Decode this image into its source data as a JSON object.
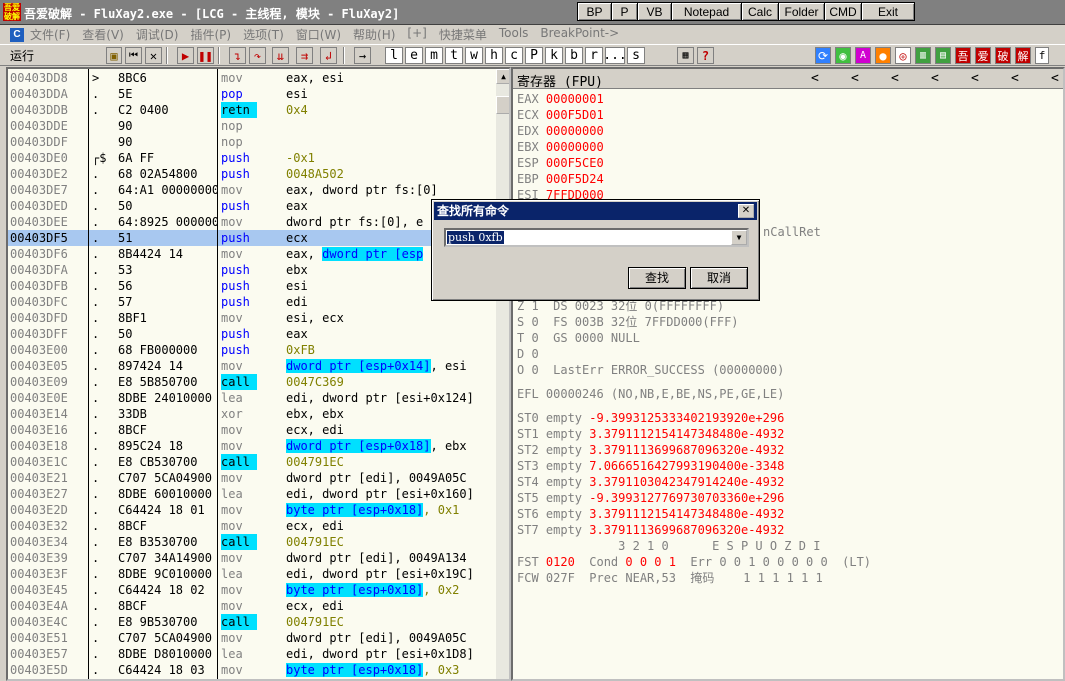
{
  "title": {
    "logo": "吾爱破解",
    "text": "吾爱破解 - FluXay2.exe - [LCG - 主线程, 模块 - FluXay2]"
  },
  "title_buttons": [
    {
      "label": "BP",
      "w": 34
    },
    {
      "label": "P",
      "w": 26
    },
    {
      "label": "VB",
      "w": 34
    },
    {
      "label": "Notepad",
      "w": 70
    },
    {
      "label": "Calc",
      "w": 37
    },
    {
      "label": "Folder",
      "w": 46
    },
    {
      "label": "CMD",
      "w": 37
    },
    {
      "label": "Exit",
      "w": 54
    }
  ],
  "menu": [
    "文件(F)",
    "查看(V)",
    "调试(D)",
    "插件(P)",
    "选项(T)",
    "窗口(W)",
    "帮助(H)",
    "[+]",
    "快捷菜单",
    "Tools",
    "BreakPoint->"
  ],
  "status": "运行",
  "toolbar_letters": [
    "l",
    "e",
    "m",
    "t",
    "w",
    "h",
    "c",
    "P",
    "k",
    "b",
    "r",
    "...",
    "s"
  ],
  "toolbar_right": [
    "吾",
    "爱",
    "破",
    "解"
  ],
  "disasm": [
    {
      "addr": "00403DD8",
      "mark": ">",
      "hex": "8BC6",
      "mn": "mov",
      "ops": "eax, esi"
    },
    {
      "addr": "00403DDA",
      "mark": ".",
      "hex": "5E",
      "mn": "pop",
      "mn_style": "blue",
      "ops": "esi"
    },
    {
      "addr": "00403DDB",
      "mark": ".",
      "hex": "C2 0400",
      "mn": "retn",
      "mn_style": "cyan",
      "ops": "0x4",
      "ops_style": "olive"
    },
    {
      "addr": "00403DDE",
      "mark": "",
      "hex": "90",
      "mn": "nop",
      "ops": ""
    },
    {
      "addr": "00403DDF",
      "mark": "",
      "hex": "90",
      "mn": "nop",
      "ops": ""
    },
    {
      "addr": "00403DE0",
      "mark": "┌$",
      "hex": "6A FF",
      "mn": "push",
      "mn_style": "blue",
      "ops": "-0x1",
      "ops_style": "olive"
    },
    {
      "addr": "00403DE2",
      "mark": ".",
      "hex": "68 02A54800",
      "mn": "push",
      "mn_style": "blue",
      "ops": "0048A502",
      "ops_style": "olive"
    },
    {
      "addr": "00403DE7",
      "mark": ".",
      "hex": "64:A1 00000000",
      "mn": "mov",
      "ops": "eax, dword ptr fs:[0]"
    },
    {
      "addr": "00403DED",
      "mark": ".",
      "hex": "50",
      "mn": "push",
      "mn_style": "blue",
      "ops": "eax"
    },
    {
      "addr": "00403DEE",
      "mark": ".",
      "hex": "64:8925 00000000",
      "mn": "mov",
      "ops": "dword ptr fs:[0], e"
    },
    {
      "addr": "00403DF5",
      "mark": ".",
      "hex": "51",
      "mn": "push",
      "mn_style": "blue",
      "ops": "ecx",
      "sel": true
    },
    {
      "addr": "00403DF6",
      "mark": ".",
      "hex": "8B4424 14",
      "mn": "mov",
      "ops_pre": "eax, ",
      "ops_hl": "dword ptr [esp"
    },
    {
      "addr": "00403DFA",
      "mark": ".",
      "hex": "53",
      "mn": "push",
      "mn_style": "blue",
      "ops": "ebx"
    },
    {
      "addr": "00403DFB",
      "mark": ".",
      "hex": "56",
      "mn": "push",
      "mn_style": "blue",
      "ops": "esi"
    },
    {
      "addr": "00403DFC",
      "mark": ".",
      "hex": "57",
      "mn": "push",
      "mn_style": "blue",
      "ops": "edi"
    },
    {
      "addr": "00403DFD",
      "mark": ".",
      "hex": "8BF1",
      "mn": "mov",
      "ops": "esi, ecx"
    },
    {
      "addr": "00403DFF",
      "mark": ".",
      "hex": "50",
      "mn": "push",
      "mn_style": "blue",
      "ops": "eax"
    },
    {
      "addr": "00403E00",
      "mark": ".",
      "hex": "68 FB000000",
      "mn": "push",
      "mn_style": "blue",
      "ops": "0xFB",
      "ops_style": "olive"
    },
    {
      "addr": "00403E05",
      "mark": ".",
      "hex": "897424 14",
      "mn": "mov",
      "ops_hl": "dword ptr [esp+0x14]",
      "ops_post": ", esi"
    },
    {
      "addr": "00403E09",
      "mark": ".",
      "hex": "E8 5B850700",
      "mn": "call",
      "mn_style": "cyan",
      "ops": "0047C369",
      "ops_style": "olive"
    },
    {
      "addr": "00403E0E",
      "mark": ".",
      "hex": "8DBE 24010000",
      "mn": "lea",
      "ops": "edi, dword ptr [esi+0x124]"
    },
    {
      "addr": "00403E14",
      "mark": ".",
      "hex": "33DB",
      "mn": "xor",
      "ops": "ebx, ebx"
    },
    {
      "addr": "00403E16",
      "mark": ".",
      "hex": "8BCF",
      "mn": "mov",
      "ops": "ecx, edi"
    },
    {
      "addr": "00403E18",
      "mark": ".",
      "hex": "895C24 18",
      "mn": "mov",
      "ops_hl": "dword ptr [esp+0x18]",
      "ops_post": ", ebx"
    },
    {
      "addr": "00403E1C",
      "mark": ".",
      "hex": "E8 CB530700",
      "mn": "call",
      "mn_style": "cyan",
      "ops": "004791EC",
      "ops_style": "olive"
    },
    {
      "addr": "00403E21",
      "mark": ".",
      "hex": "C707 5CA04900",
      "mn": "mov",
      "ops": "dword ptr [edi], 0049A05C"
    },
    {
      "addr": "00403E27",
      "mark": ".",
      "hex": "8DBE 60010000",
      "mn": "lea",
      "ops": "edi, dword ptr [esi+0x160]"
    },
    {
      "addr": "00403E2D",
      "mark": ".",
      "hex": "C64424 18 01",
      "mn": "mov",
      "ops_hl": "byte ptr [esp+0x18]",
      "ops_post": ", 0x1",
      "post_olive": true
    },
    {
      "addr": "00403E32",
      "mark": ".",
      "hex": "8BCF",
      "mn": "mov",
      "ops": "ecx, edi"
    },
    {
      "addr": "00403E34",
      "mark": ".",
      "hex": "E8 B3530700",
      "mn": "call",
      "mn_style": "cyan",
      "ops": "004791EC",
      "ops_style": "olive"
    },
    {
      "addr": "00403E39",
      "mark": ".",
      "hex": "C707 34A14900",
      "mn": "mov",
      "ops": "dword ptr [edi], 0049A134"
    },
    {
      "addr": "00403E3F",
      "mark": ".",
      "hex": "8DBE 9C010000",
      "mn": "lea",
      "ops": "edi, dword ptr [esi+0x19C]"
    },
    {
      "addr": "00403E45",
      "mark": ".",
      "hex": "C64424 18 02",
      "mn": "mov",
      "ops_hl": "byte ptr [esp+0x18]",
      "ops_post": ", 0x2",
      "post_olive": true
    },
    {
      "addr": "00403E4A",
      "mark": ".",
      "hex": "8BCF",
      "mn": "mov",
      "ops": "ecx, edi"
    },
    {
      "addr": "00403E4C",
      "mark": ".",
      "hex": "E8 9B530700",
      "mn": "call",
      "mn_style": "cyan",
      "ops": "004791EC",
      "ops_style": "olive"
    },
    {
      "addr": "00403E51",
      "mark": ".",
      "hex": "C707 5CA04900",
      "mn": "mov",
      "ops": "dword ptr [edi], 0049A05C"
    },
    {
      "addr": "00403E57",
      "mark": ".",
      "hex": "8DBE D8010000",
      "mn": "lea",
      "ops": "edi, dword ptr [esi+0x1D8]"
    },
    {
      "addr": "00403E5D",
      "mark": ".",
      "hex": "C64424 18 03",
      "mn": "mov",
      "ops_hl": "byte ptr [esp+0x18]",
      "ops_post": ", 0x3",
      "post_olive": true
    }
  ],
  "registers": {
    "title": "寄存器 (FPU)",
    "gpr": [
      {
        "name": "EAX",
        "value": "00000001"
      },
      {
        "name": "ECX",
        "value": "000F5D01"
      },
      {
        "name": "EDX",
        "value": "00000000"
      },
      {
        "name": "EBX",
        "value": "00000000"
      },
      {
        "name": "ESP",
        "value": "000F5CE0"
      },
      {
        "name": "EBP",
        "value": "000F5D24"
      },
      {
        "name": "ESI",
        "value": "7FFDD000"
      }
    ],
    "partial_text": "nCallRet",
    "flags": [
      "Z 1  DS 0023 32位 0(FFFFFFFF)",
      "S 0  FS 003B 32位 7FFDD000(FFF)",
      "T 0  GS 0000 NULL",
      "D 0",
      "O 0  LastErr ERROR_SUCCESS (00000000)"
    ],
    "efl": "EFL 00000246 (NO,NB,E,BE,NS,PE,GE,LE)",
    "st": [
      {
        "name": "ST0",
        "state": "empty",
        "value": "-9.3993125333402193920e+296"
      },
      {
        "name": "ST1",
        "state": "empty",
        "value": "3.3791112154147348480e-4932"
      },
      {
        "name": "ST2",
        "state": "empty",
        "value": "3.3791113699687096320e-4932"
      },
      {
        "name": "ST3",
        "state": "empty",
        "value": "7.0666516427993190400e-3348"
      },
      {
        "name": "ST4",
        "state": "empty",
        "value": "3.3791103042347914240e-4932"
      },
      {
        "name": "ST5",
        "state": "empty",
        "value": "-9.3993127769730703360e+296"
      },
      {
        "name": "ST6",
        "state": "empty",
        "value": "3.3791112154147348480e-4932"
      },
      {
        "name": "ST7",
        "state": "empty",
        "value": "3.3791113699687096320e-4932"
      }
    ],
    "bits_hdr": "              3 2 1 0      E S P U O Z D I",
    "fst_label": "FST",
    "fst_value": "0120",
    "fst_rest": "  Cond ",
    "fst_cond_red": "0 0 0 1",
    "fst_err": "  Err 0 0 1 0 0 0 0 0  (LT)",
    "fcw": "FCW 027F  Prec NEAR,53  掩码    1 1 1 1 1 1"
  },
  "dialog": {
    "title": "查找所有命令",
    "value": "push 0xfb",
    "find_label": "查找",
    "cancel_label": "取消"
  }
}
